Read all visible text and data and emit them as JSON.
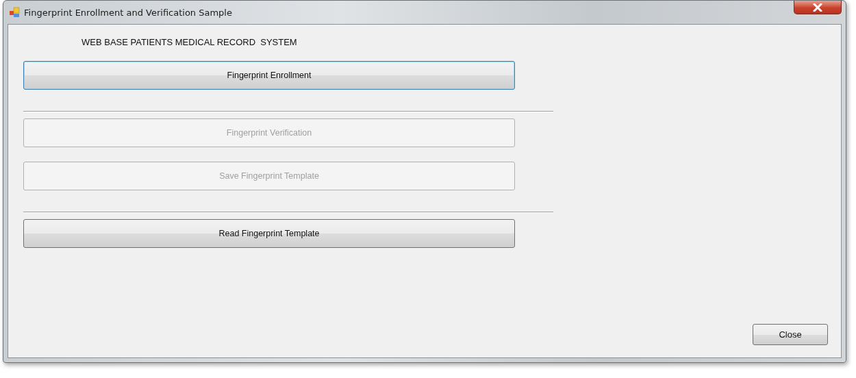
{
  "window": {
    "title": "Fingerprint Enrollment and Verification Sample"
  },
  "heading": "WEB BASE PATIENTS MEDICAL RECORD  SYSTEM",
  "buttons": [
    {
      "label": "Fingerprint Enrollment",
      "disabled": false,
      "focused": true,
      "separator_before": false
    },
    {
      "label": "Fingerprint Verification",
      "disabled": true,
      "focused": false,
      "separator_before": true
    },
    {
      "label": "Save Fingerprint Template",
      "disabled": true,
      "focused": false,
      "separator_before": false
    },
    {
      "label": "Read Fingerprint Template",
      "disabled": false,
      "focused": false,
      "separator_before": true
    }
  ],
  "close_button": {
    "label": "Close"
  }
}
